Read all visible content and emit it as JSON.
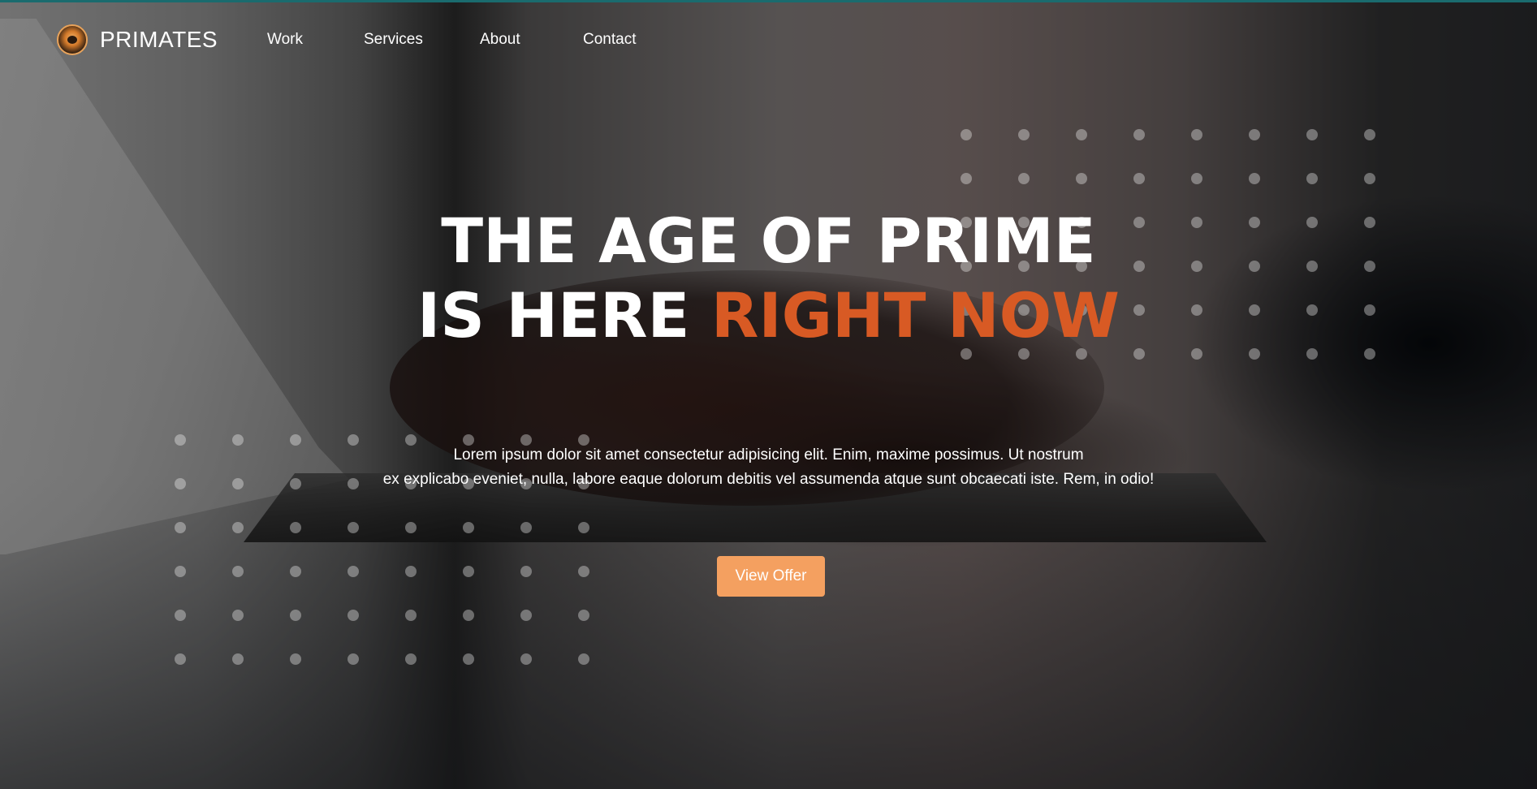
{
  "brand": {
    "name": "PRIMATES",
    "logo_icon": "chimp-logo-icon"
  },
  "nav": {
    "items": [
      {
        "label": "Work"
      },
      {
        "label": "Services"
      },
      {
        "label": "About"
      },
      {
        "label": "Contact"
      }
    ]
  },
  "hero": {
    "headline_line1": "THE AGE OF PRIME",
    "headline_line2_white": "IS HERE ",
    "headline_line2_accent": "RIGHT NOW",
    "body_line1": "Lorem ipsum dolor sit amet consectetur adipisicing elit. Enim, maxime possimus. Ut nostrum",
    "body_line2": "ex explicabo eveniet, nulla, labore eaque dolorum debitis vel assumenda atque sunt obcaecati iste. Rem, in odio!",
    "cta_label": "View Offer"
  },
  "colors": {
    "accent": "#d85a24",
    "button": "#f4a060",
    "top_border": "#1a6b6e"
  }
}
